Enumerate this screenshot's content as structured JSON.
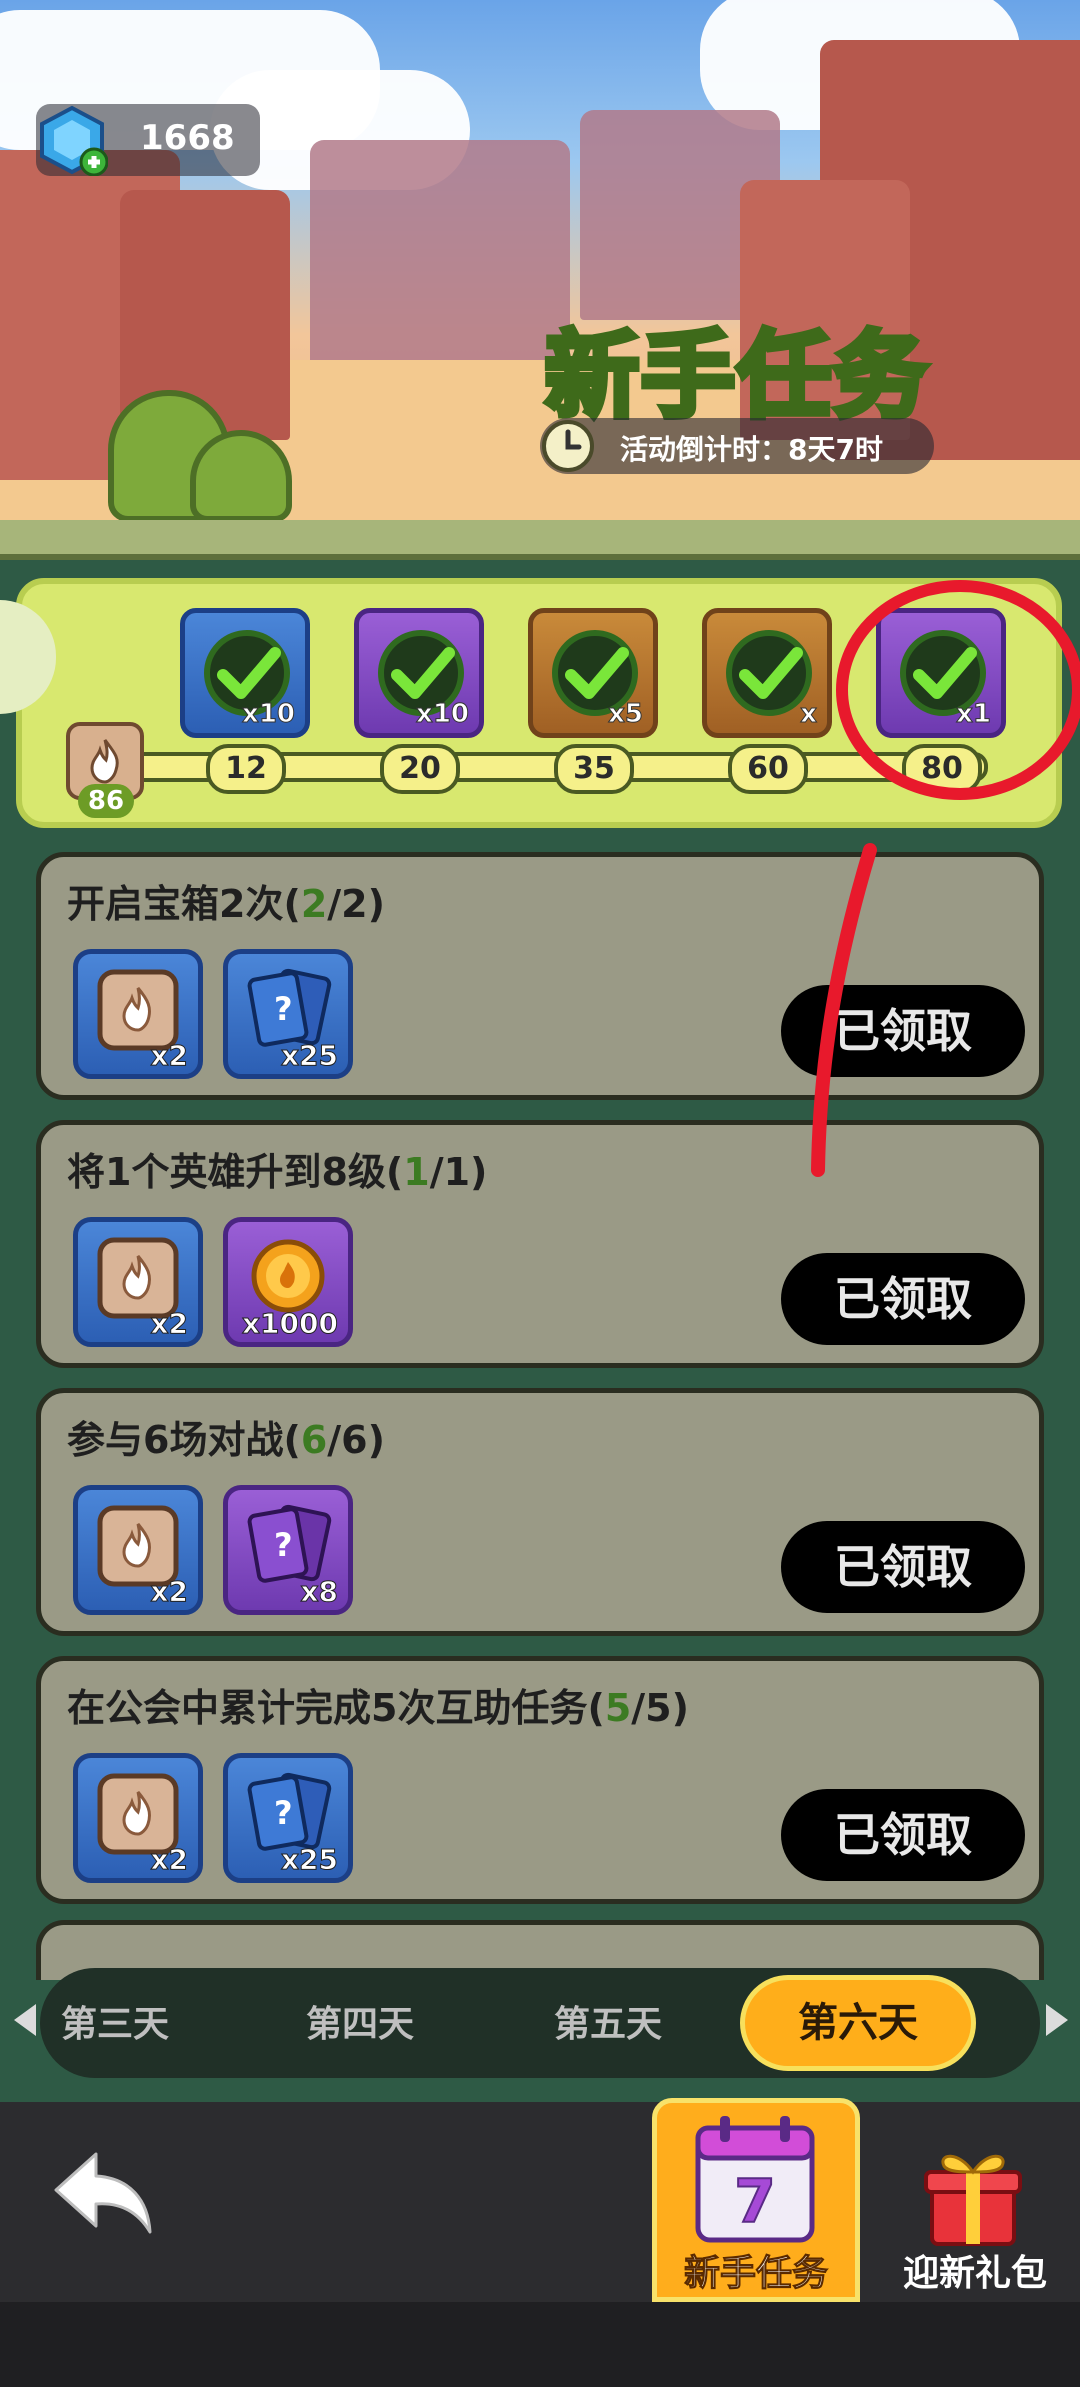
{
  "header": {
    "currency_value": "1668",
    "title": "新手任务",
    "countdown": "活动倒计时：8天7时"
  },
  "progress": {
    "points": "86",
    "milestones": [
      {
        "threshold": "12",
        "reward_qty": "x10",
        "chest": "blue",
        "claimed": true
      },
      {
        "threshold": "20",
        "reward_qty": "x10",
        "chest": "purple",
        "claimed": true
      },
      {
        "threshold": "35",
        "reward_qty": "x5",
        "chest": "orange",
        "claimed": true
      },
      {
        "threshold": "60",
        "reward_qty": "x",
        "chest": "orange",
        "claimed": true
      },
      {
        "threshold": "80",
        "reward_qty": "x1",
        "chest": "purple",
        "claimed": true
      }
    ]
  },
  "tasks": [
    {
      "title_prefix": "开启宝箱2次(",
      "done": "2",
      "sep": "/",
      "total": "2",
      "title_suffix": ")",
      "rewards": [
        {
          "icon": "fire-token-icon",
          "qty": "x2"
        },
        {
          "icon": "blue-card-pack-icon",
          "qty": "x25"
        }
      ],
      "button": "已领取"
    },
    {
      "title_prefix": "将1个英雄升到8级(",
      "done": "1",
      "sep": "/",
      "total": "1",
      "title_suffix": ")",
      "rewards": [
        {
          "icon": "fire-token-icon",
          "qty": "x2"
        },
        {
          "icon": "gold-coin-icon",
          "qty": "x1000"
        }
      ],
      "button": "已领取"
    },
    {
      "title_prefix": "参与6场对战(",
      "done": "6",
      "sep": "/",
      "total": "6",
      "title_suffix": ")",
      "rewards": [
        {
          "icon": "fire-token-icon",
          "qty": "x2"
        },
        {
          "icon": "purple-card-pack-icon",
          "qty": "x8"
        }
      ],
      "button": "已领取"
    },
    {
      "title_prefix": "在公会中累计完成5次互助任务(",
      "done": "5",
      "sep": "/",
      "total": "5",
      "title_suffix": ")",
      "rewards": [
        {
          "icon": "fire-token-icon",
          "qty": "x2"
        },
        {
          "icon": "blue-card-pack-icon",
          "qty": "x25"
        }
      ],
      "button": "已领取"
    }
  ],
  "day_tabs": [
    "第三天",
    "第四天",
    "第五天",
    "第六天"
  ],
  "bottom_nav": {
    "active_label": "新手任务",
    "calendar_number": "7",
    "gift_label": "迎新礼包"
  },
  "colors": {
    "accent": "#ffae1a",
    "progress_panel": "#d8e86f",
    "card_bg": "#9a9a86",
    "annotation": "#e8192c"
  }
}
